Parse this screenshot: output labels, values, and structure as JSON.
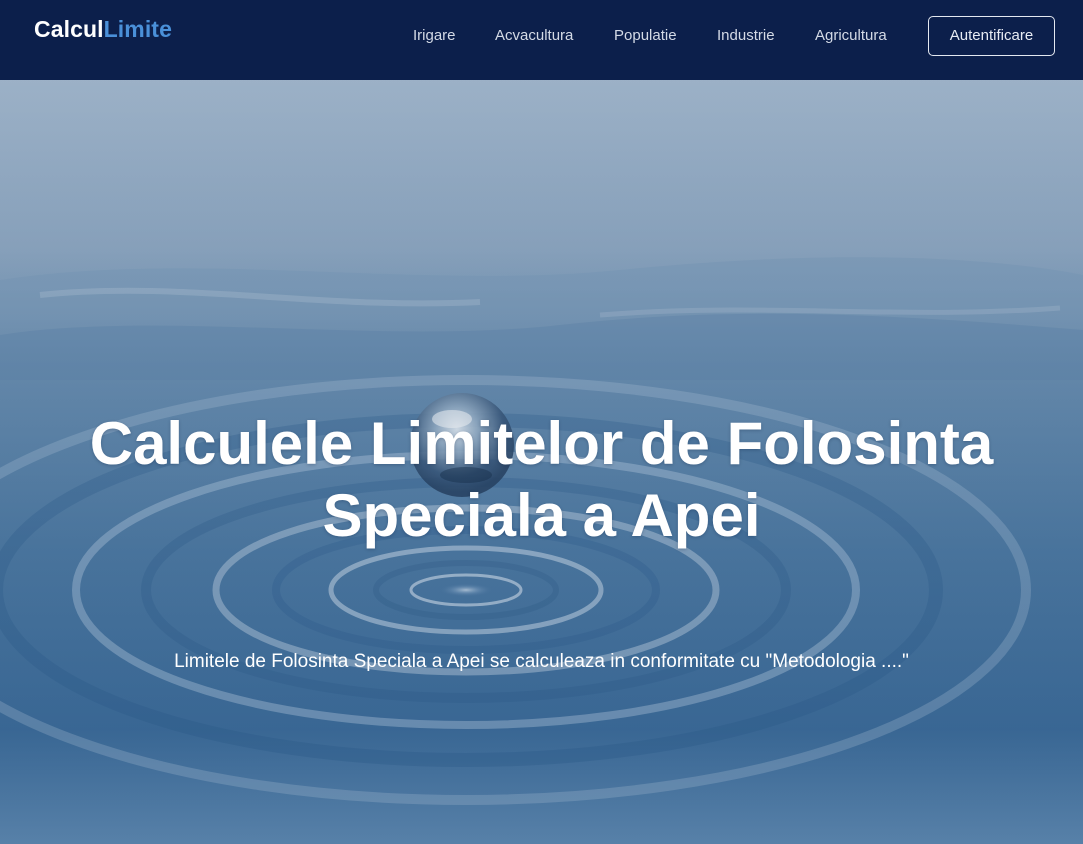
{
  "navbar": {
    "brand_primary": "Calcul",
    "brand_accent": "Limite",
    "links": [
      {
        "label": "Irigare"
      },
      {
        "label": "Acvacultura"
      },
      {
        "label": "Populatie"
      },
      {
        "label": "Industrie"
      },
      {
        "label": "Agricultura"
      }
    ],
    "auth_label": "Autentificare"
  },
  "hero": {
    "title_line1": "Calculele Limitelor de Folosinta",
    "title_line2": "Speciala a Apei",
    "subtitle": "Limitele de Folosinta Speciala a Apei se calculeaza in conformitate cu \"Metodologia ....\""
  },
  "colors": {
    "navbar_bg": "#0c1f4b",
    "brand_accent": "#4a90d9",
    "water_top": "#8ea6bf",
    "water_bottom": "#2f5f93"
  }
}
